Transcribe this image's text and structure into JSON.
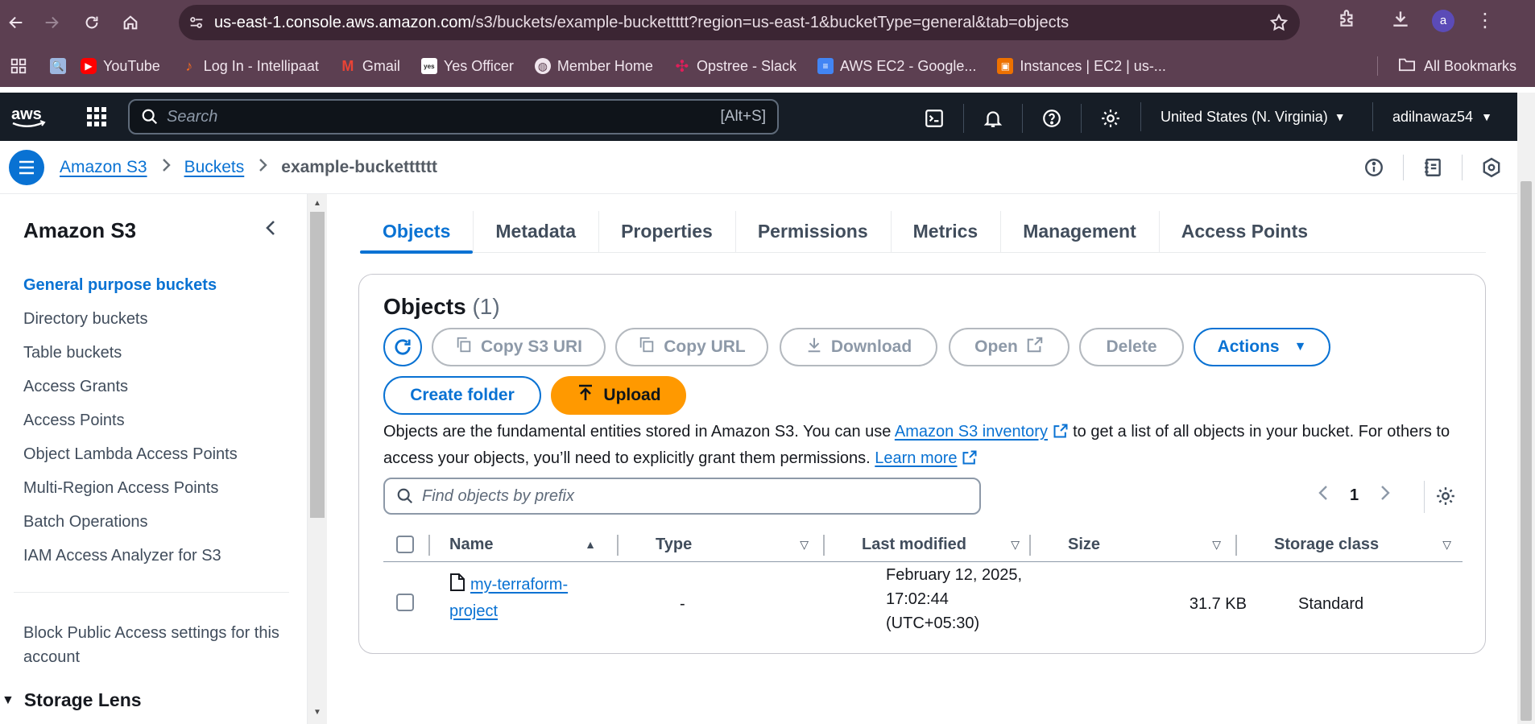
{
  "browser": {
    "url_host": "us-east-1.console.aws.amazon.com",
    "url_path": "/s3/buckets/example-buckettttt?region=us-east-1&bucketType=general&tab=objects",
    "avatar_letter": "a",
    "bookmarks": [
      {
        "label": "",
        "icon": "image-search-icon",
        "color": "#9db7e0"
      },
      {
        "label": "YouTube",
        "icon": "youtube-icon",
        "color": "#ff0000"
      },
      {
        "label": "Log In - Intellipaat",
        "icon": "intellipaat-icon",
        "color": "#f26a21"
      },
      {
        "label": "Gmail",
        "icon": "gmail-icon",
        "color": "#ea4335"
      },
      {
        "label": "Yes Officer",
        "icon": "yes-officer-icon",
        "color": "#222222"
      },
      {
        "label": "Member Home",
        "icon": "member-home-icon",
        "color": "#ffffff"
      },
      {
        "label": "Opstree - Slack",
        "icon": "slack-icon",
        "color": "#e01e5a"
      },
      {
        "label": "AWS EC2 - Google...",
        "icon": "google-docs-icon",
        "color": "#4285f4"
      },
      {
        "label": "Instances | EC2 | us-...",
        "icon": "aws-ec2-icon",
        "color": "#ed7100"
      }
    ],
    "all_bookmarks": "All Bookmarks"
  },
  "aws_nav": {
    "search_placeholder": "Search",
    "search_shortcut": "[Alt+S]",
    "region": "United States (N. Virginia)",
    "user": "adilnawaz54"
  },
  "breadcrumb": {
    "items": [
      "Amazon S3",
      "Buckets"
    ],
    "current": "example-bucketttttt"
  },
  "sidebar": {
    "title": "Amazon S3",
    "items": [
      {
        "label": "General purpose buckets",
        "active": true
      },
      {
        "label": "Directory buckets"
      },
      {
        "label": "Table buckets"
      },
      {
        "label": "Access Grants"
      },
      {
        "label": "Access Points"
      },
      {
        "label": "Object Lambda Access Points"
      },
      {
        "label": "Multi-Region Access Points"
      },
      {
        "label": "Batch Operations"
      },
      {
        "label": "IAM Access Analyzer for S3"
      }
    ],
    "block_public_access": "Block Public Access settings for this account",
    "storage_lens": "Storage Lens"
  },
  "tabs": [
    "Objects",
    "Metadata",
    "Properties",
    "Permissions",
    "Metrics",
    "Management",
    "Access Points"
  ],
  "objects": {
    "title": "Objects",
    "count": "(1)",
    "buttons": {
      "copy_s3_uri": "Copy S3 URI",
      "copy_url": "Copy URL",
      "download": "Download",
      "open": "Open",
      "delete": "Delete",
      "actions": "Actions",
      "create_folder": "Create folder",
      "upload": "Upload"
    },
    "description_1": "Objects are the fundamental entities stored in Amazon S3. You can use ",
    "inventory_link": "Amazon S3 inventory",
    "description_2": " to get a list of all objects in your bucket. For others to access your objects, you’ll need to explicitly grant them permissions. ",
    "learn_more": "Learn more",
    "find_placeholder": "Find objects by prefix",
    "page": "1",
    "columns": [
      "Name",
      "Type",
      "Last modified",
      "Size",
      "Storage class"
    ],
    "rows": [
      {
        "name_line1": "my-terraform-",
        "name_line2": "project",
        "type": "-",
        "modified_line1": "February 12, 2025,",
        "modified_line2": "17:02:44",
        "modified_line3": "(UTC+05:30)",
        "size": "31.7 KB",
        "storage_class": "Standard"
      }
    ]
  }
}
